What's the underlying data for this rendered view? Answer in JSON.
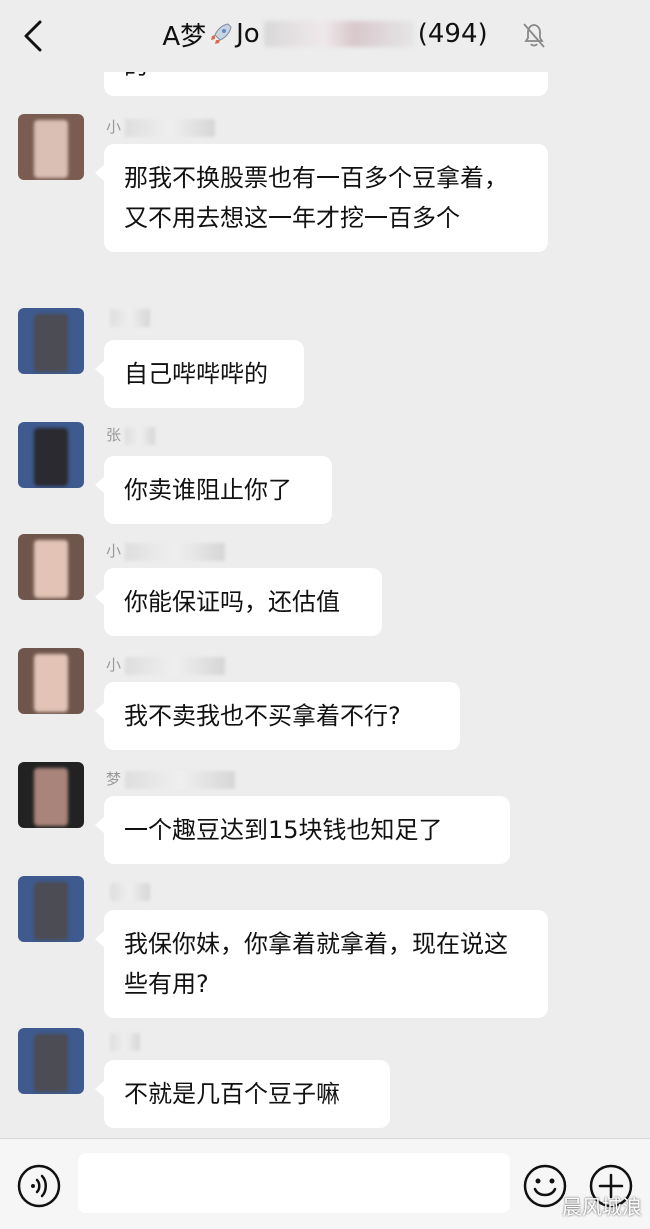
{
  "header": {
    "title_prefix": "A梦",
    "title_mid": "Jo",
    "title_count": "(494)"
  },
  "top_partial": "的",
  "messages": [
    {
      "nick": "小",
      "text": "那我不换股票也有一百多个豆拿着，又不用去想这一年才挖一百多个"
    },
    {
      "nick": "",
      "text": "自己哔哔哔的"
    },
    {
      "nick": "张",
      "text": "你卖谁阻止你了"
    },
    {
      "nick": "小",
      "text": "你能保证吗，还估值"
    },
    {
      "nick": "小",
      "text": "我不卖我也不买拿着不行?"
    },
    {
      "nick": "梦",
      "text": "一个趣豆达到15块钱也知足了"
    },
    {
      "nick": "",
      "text": "我保你妹，你拿着就拿着，现在说这些有用?"
    },
    {
      "nick": "",
      "text": "不就是几百个豆子嘛"
    }
  ],
  "watermark": "晨风城浪",
  "colors": {
    "background": "#ededed",
    "bubble": "#ffffff",
    "text": "#111111"
  }
}
